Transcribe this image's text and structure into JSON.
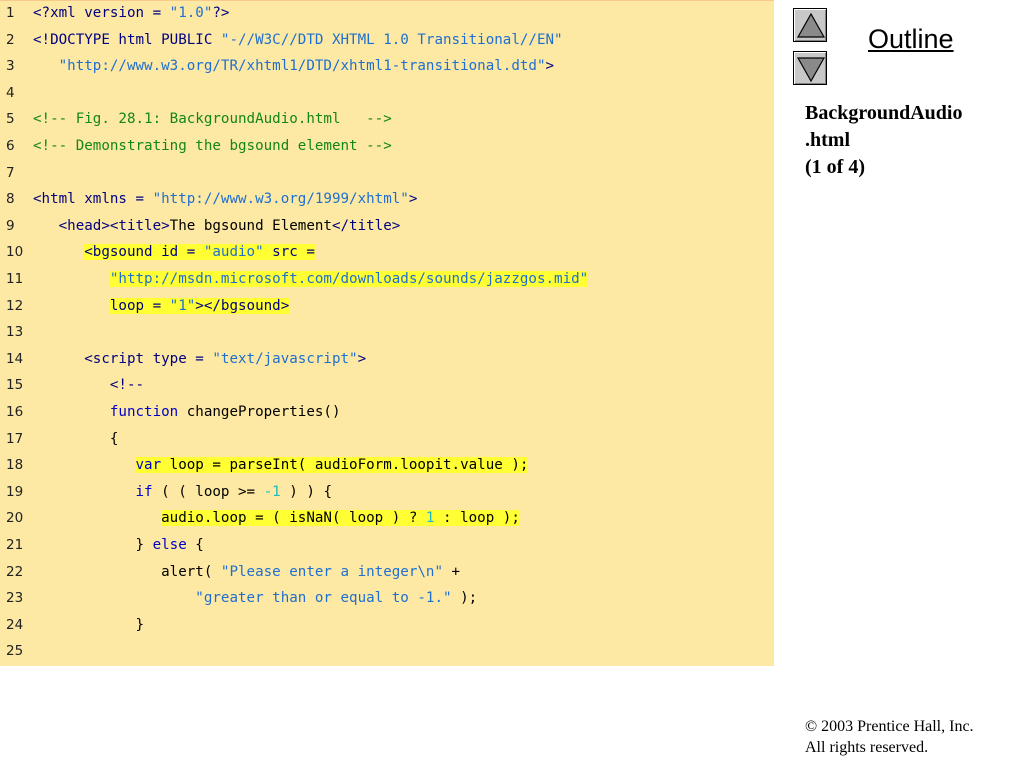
{
  "sidebar": {
    "outline_label": "Outline",
    "caption_lines": [
      "BackgroundAudio",
      ".html",
      "(1 of 4)"
    ],
    "up_icon": "triangle-up-icon",
    "down_icon": "triangle-down-icon"
  },
  "copyright": {
    "line1": "© 2003 Prentice Hall, Inc.",
    "line2": "All rights reserved."
  },
  "colors": {
    "panel": "#fde9a4",
    "highlight": "#ffff33",
    "tag": "#000080",
    "string": "#1f6fd0",
    "number": "#19b9c9",
    "comment": "#13861a",
    "keyword": "#0000c8"
  },
  "code": [
    {
      "n": "1",
      "indent": "",
      "tokens": [
        [
          "tag",
          "<?xml version = "
        ],
        [
          "str",
          "\"1.0\""
        ],
        [
          "tag",
          "?>"
        ]
      ]
    },
    {
      "n": "2",
      "indent": "",
      "tokens": [
        [
          "tag",
          "<!DOCTYPE html PUBLIC "
        ],
        [
          "str",
          "\"-//W3C//DTD XHTML 1.0 Transitional//EN\""
        ]
      ]
    },
    {
      "n": "3",
      "indent": "   ",
      "tokens": [
        [
          "str",
          "\"http://www.w3.org/TR/xhtml1/DTD/xhtml1-transitional.dtd\""
        ],
        [
          "tag",
          ">"
        ]
      ]
    },
    {
      "n": "4",
      "indent": "",
      "tokens": []
    },
    {
      "n": "5",
      "indent": "",
      "tokens": [
        [
          "com",
          "<!-- Fig. 28.1: BackgroundAudio.html   -->"
        ]
      ]
    },
    {
      "n": "6",
      "indent": "",
      "tokens": [
        [
          "com",
          "<!-- Demonstrating the bgsound element -->"
        ]
      ]
    },
    {
      "n": "7",
      "indent": "",
      "tokens": []
    },
    {
      "n": "8",
      "indent": "",
      "tokens": [
        [
          "tag",
          "<html xmlns = "
        ],
        [
          "str",
          "\"http://www.w3.org/1999/xhtml\""
        ],
        [
          "tag",
          ">"
        ]
      ]
    },
    {
      "n": "9",
      "indent": "   ",
      "tokens": [
        [
          "tag",
          "<head><title>"
        ],
        [
          "pl",
          "The bgsound Element"
        ],
        [
          "tag",
          "</title>"
        ]
      ]
    },
    {
      "n": "10",
      "indent": "      ",
      "hl": true,
      "tokens": [
        [
          "tag",
          "<bgsound id = "
        ],
        [
          "str",
          "\"audio\""
        ],
        [
          "tag",
          " src ="
        ]
      ]
    },
    {
      "n": "11",
      "indent": "         ",
      "hl": true,
      "tokens": [
        [
          "str",
          "\"http://msdn.microsoft.com/downloads/sounds/jazzgos.mid\""
        ]
      ]
    },
    {
      "n": "12",
      "indent": "         ",
      "hl": true,
      "tokens": [
        [
          "tag",
          "loop = "
        ],
        [
          "str",
          "\"1\""
        ],
        [
          "tag",
          "></bgsound>"
        ]
      ]
    },
    {
      "n": "13",
      "indent": "",
      "tokens": []
    },
    {
      "n": "14",
      "indent": "      ",
      "tokens": [
        [
          "tag",
          "<script type = "
        ],
        [
          "str",
          "\"text/javascript\""
        ],
        [
          "tag",
          ">"
        ]
      ]
    },
    {
      "n": "15",
      "indent": "         ",
      "tokens": [
        [
          "tag",
          "<!--"
        ]
      ]
    },
    {
      "n": "16",
      "indent": "         ",
      "tokens": [
        [
          "kw",
          "function"
        ],
        [
          "pl",
          " changeProperties()"
        ]
      ]
    },
    {
      "n": "17",
      "indent": "         ",
      "tokens": [
        [
          "pl",
          "{"
        ]
      ]
    },
    {
      "n": "18",
      "indent": "            ",
      "hl": true,
      "tokens": [
        [
          "kw",
          "var"
        ],
        [
          "pl",
          " loop = parseInt( audioForm.loopit.value );"
        ]
      ]
    },
    {
      "n": "19",
      "indent": "            ",
      "tokens": [
        [
          "kw",
          "if"
        ],
        [
          "pl",
          " ( ( loop >= "
        ],
        [
          "num",
          "-1"
        ],
        [
          "pl",
          " ) ) {"
        ]
      ]
    },
    {
      "n": "20",
      "indent": "               ",
      "hl": true,
      "tokens": [
        [
          "pl",
          "audio.loop = ( isNaN( loop ) ? "
        ],
        [
          "num",
          "1"
        ],
        [
          "pl",
          " : loop );"
        ]
      ]
    },
    {
      "n": "21",
      "indent": "            ",
      "tokens": [
        [
          "pl",
          "} "
        ],
        [
          "kw",
          "else"
        ],
        [
          "pl",
          " {"
        ]
      ]
    },
    {
      "n": "22",
      "indent": "               ",
      "tokens": [
        [
          "pl",
          "alert( "
        ],
        [
          "str",
          "\"Please enter a integer\\n\""
        ],
        [
          "pl",
          " +"
        ]
      ]
    },
    {
      "n": "23",
      "indent": "                   ",
      "tokens": [
        [
          "str",
          "\"greater than or equal to -1.\""
        ],
        [
          "pl",
          " );"
        ]
      ]
    },
    {
      "n": "24",
      "indent": "            ",
      "tokens": [
        [
          "pl",
          "}"
        ]
      ]
    },
    {
      "n": "25",
      "indent": "",
      "tokens": []
    }
  ]
}
